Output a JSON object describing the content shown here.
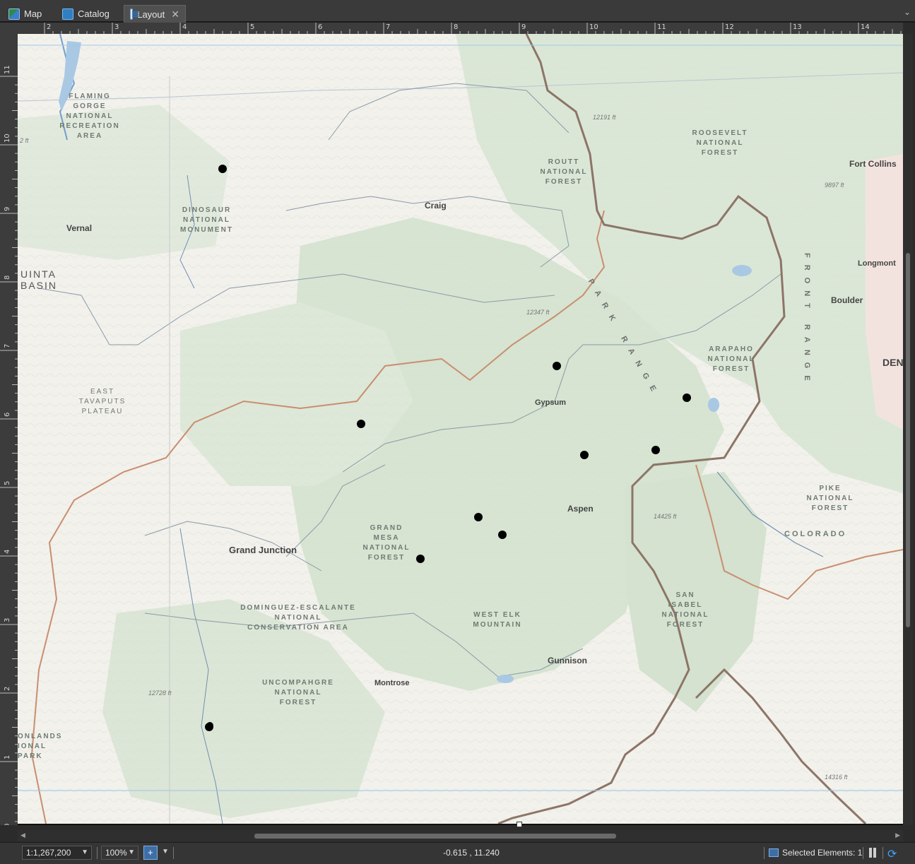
{
  "tabs": [
    {
      "label": "Map",
      "icon": "map-icon"
    },
    {
      "label": "Catalog",
      "icon": "catalog-icon"
    },
    {
      "label": "Layout",
      "icon": "layout-icon",
      "active": true
    }
  ],
  "ruler": {
    "top_labels": [
      "2",
      "3",
      "4",
      "5",
      "6",
      "7",
      "8",
      "9",
      "10",
      "11",
      "12",
      "13",
      "14"
    ],
    "left_labels": [
      "11",
      "10",
      "9",
      "8",
      "7",
      "6",
      "5",
      "4",
      "3",
      "2",
      "1",
      "0"
    ]
  },
  "map": {
    "cities": [
      "Craig",
      "Vernal",
      "Fort Collins",
      "Longmont",
      "Boulder",
      "DEN",
      "Gypsum",
      "Aspen",
      "Grand Junction",
      "Montrose",
      "Gunnison"
    ],
    "regions": {
      "flaming_gorge": "FLAMING GORGE NATIONAL RECREATION AREA",
      "dinosaur": "DINOSAUR NATIONAL MONUMENT",
      "uinta": "UINTA BASIN",
      "east_tavaputs": "EAST TAVAPUTS PLATEAU",
      "routt": "ROUTT NATIONAL FOREST",
      "roosevelt": "ROOSEVELT NATIONAL FOREST",
      "arapaho": "ARAPAHO NATIONAL FOREST",
      "grand_mesa": "GRAND MESA NATIONAL FOREST",
      "pike": "PIKE NATIONAL FOREST",
      "colorado": "COLORADO",
      "dominguez": "DOMINGUEZ-ESCALANTE NATIONAL CONSERVATION AREA",
      "west_elk": "WEST ELK MOUNTAIN",
      "san_isabel": "SAN ISABEL NATIONAL FOREST",
      "uncompahgre": "UNCOMPAHGRE NATIONAL FOREST",
      "canyonlands": "ONLANDS IONAL PARK"
    },
    "ranges": {
      "park": "PARK RANGE",
      "front": "FRONT RANGE"
    },
    "elevations": [
      "12191 ft",
      "9897 ft",
      "12347 ft",
      "14425 ft",
      "12728 ft",
      "14316 ft",
      "2 ft"
    ],
    "point_count": 11
  },
  "status": {
    "scale": "1:1,267,200",
    "zoom": "100%",
    "coordinates": "-0.615 , 11.240",
    "selected": "Selected Elements: 1"
  }
}
